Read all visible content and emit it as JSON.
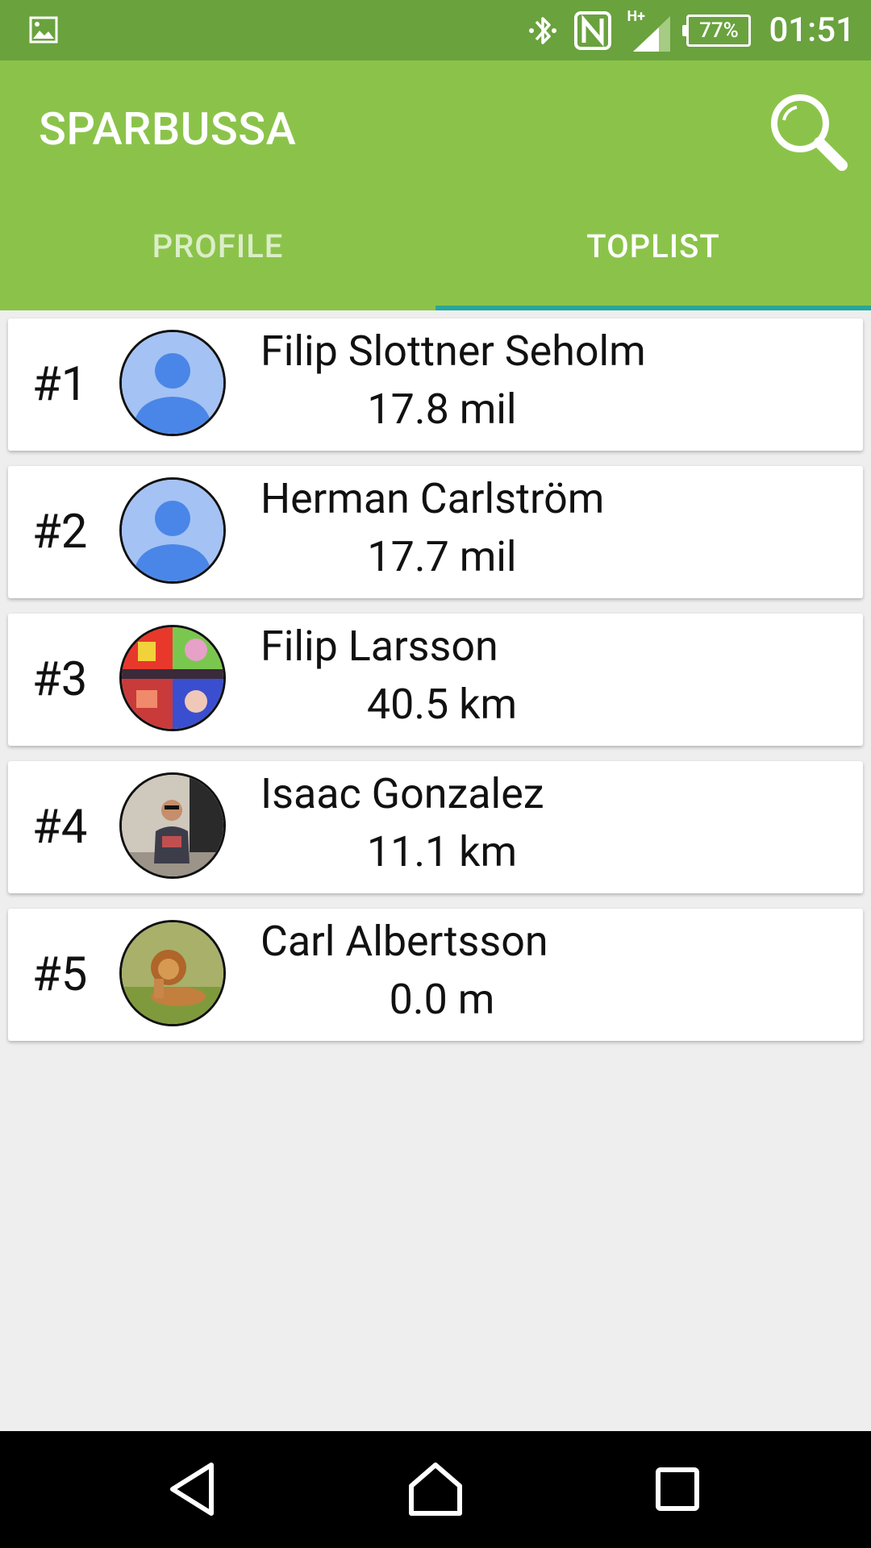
{
  "status_bar": {
    "time": "01:51",
    "battery": "77%",
    "network_label": "H+",
    "icons": [
      "image-notification-icon",
      "bluetooth-icon",
      "nfc-icon",
      "signal-icon",
      "battery-icon"
    ]
  },
  "app_bar": {
    "title": "SPARBUSSA",
    "search_icon": "search-icon",
    "color": "#8bc34a"
  },
  "tabs": [
    {
      "label": "PROFILE",
      "selected": false
    },
    {
      "label": "TOPLIST",
      "selected": true
    }
  ],
  "toplist": [
    {
      "rank": "#1",
      "name": "Filip Slottner Seholm",
      "distance": "17.8 mil",
      "avatar": "default-avatar"
    },
    {
      "rank": "#2",
      "name": "Herman Carlström",
      "distance": "17.7 mil",
      "avatar": "default-avatar"
    },
    {
      "rank": "#3",
      "name": "Filip Larsson",
      "distance": "40.5 km",
      "avatar": "photo-collage"
    },
    {
      "rank": "#4",
      "name": "Isaac Gonzalez",
      "distance": "11.1 km",
      "avatar": "photo-person"
    },
    {
      "rank": "#5",
      "name": "Carl Albertsson",
      "distance": "0.0 m",
      "avatar": "photo-lion"
    }
  ],
  "nav_bar": {
    "buttons": [
      "back-icon",
      "home-icon",
      "recent-apps-icon"
    ]
  },
  "colors": {
    "status_bar": "#6aa23e",
    "app_bar": "#8bc34a",
    "tab_indicator": "#26a69a",
    "background": "#eeeeee"
  }
}
